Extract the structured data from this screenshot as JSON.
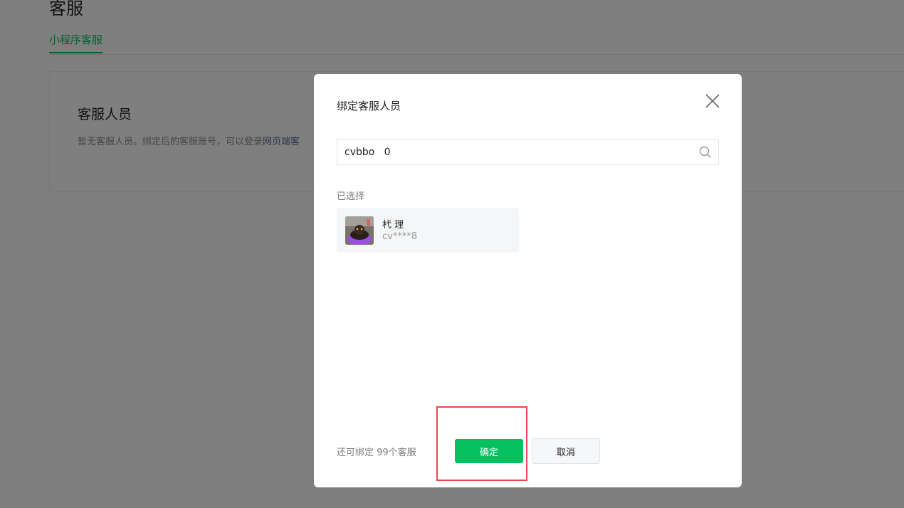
{
  "page": {
    "title": "客服",
    "tabs": [
      {
        "label": "小程序客服",
        "active": true
      }
    ]
  },
  "card": {
    "title": "客服人员",
    "description": "暂无客服人员。绑定后的客服账号，可以登录",
    "description_link": "网页端客"
  },
  "dialog": {
    "title": "绑定客服人员",
    "search_value": "cvbbo   0",
    "selected_label": "已选择",
    "selected_members": [
      {
        "name": "杙  理",
        "id": "cv****8",
        "avatar": "avatar-image"
      }
    ],
    "quota_text": "还可绑定 99个客服",
    "confirm_label": "确定",
    "cancel_label": "取消"
  },
  "colors": {
    "accent": "#07c160",
    "highlight": "#e5484d",
    "overlay": "rgba(0,0,0,0.5)"
  },
  "icons": {
    "close": "close-icon",
    "search": "search-icon"
  }
}
